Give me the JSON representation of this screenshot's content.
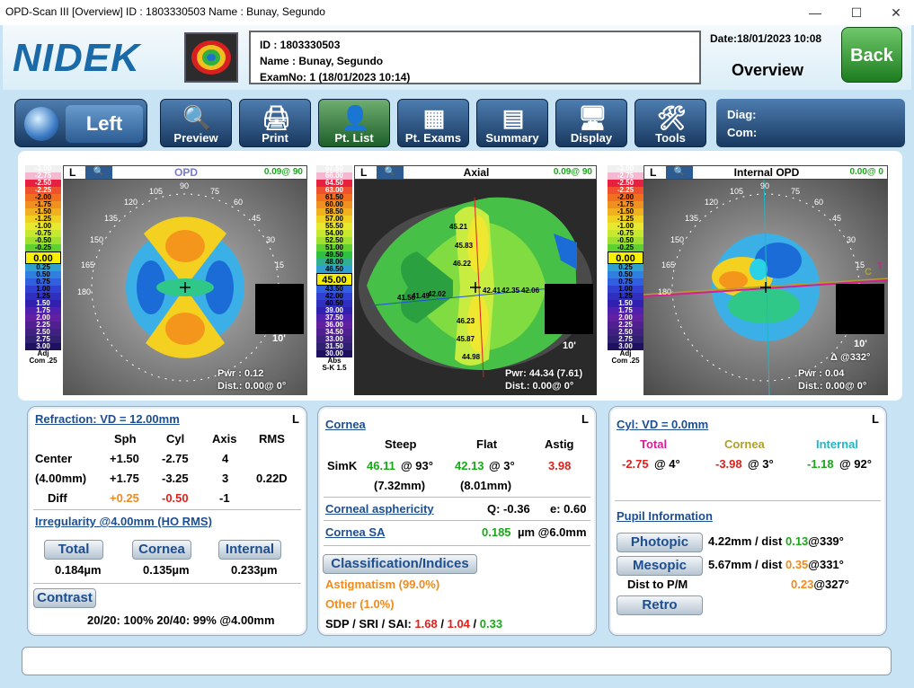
{
  "window": {
    "title": "OPD-Scan III  [Overview]  ID : 1803330503  Name : Bunay,  Segundo",
    "min": "—",
    "max": "☐",
    "close": "✕"
  },
  "header": {
    "logo": "NIDEK",
    "id_line": "ID : 1803330503",
    "name_line": "Name : Bunay,  Segundo",
    "exam_line": "ExamNo: 1 (18/01/2023 10:14)",
    "date": "Date:18/01/2023 10:08",
    "view": "Overview",
    "back": "Back"
  },
  "toolbar": {
    "eye": "Left",
    "buttons": [
      {
        "label": "Preview",
        "icon": "magnifier-icon"
      },
      {
        "label": "Print",
        "icon": "printer-icon"
      },
      {
        "label": "Pt. List",
        "icon": "person-icon"
      },
      {
        "label": "Pt. Exams",
        "icon": "exam-grid-icon"
      },
      {
        "label": "Summary",
        "icon": "summary-icon"
      },
      {
        "label": "Display",
        "icon": "display-icon"
      },
      {
        "label": "Tools",
        "icon": "tools-icon"
      }
    ],
    "diag": "Diag:",
    "com": "Com:"
  },
  "maps": [
    {
      "eye": "L",
      "title": "OPD",
      "angle": "0.09@ 90",
      "pwr": "Pwr :  0.12",
      "dist": "Dist.:  0.00@  0°",
      "scale_label": "Adj",
      "scale_sub": "Com .25",
      "box": "10'",
      "scale": [
        "-3.00",
        "-2.75",
        "-2.50",
        "-2.25",
        "-2.00",
        "-1.75",
        "-1.50",
        "-1.25",
        "-1.00",
        "-0.75",
        "-0.50",
        "-0.25",
        "0.00",
        "0.25",
        "0.50",
        "0.75",
        "1.00",
        "1.25",
        "1.50",
        "1.75",
        "2.00",
        "2.25",
        "2.50",
        "2.75",
        "3.00"
      ],
      "center_index": 12,
      "labels": [
        "90",
        "75",
        "60",
        "45",
        "30",
        "15",
        "105",
        "120",
        "135",
        "150",
        "165",
        "180"
      ]
    },
    {
      "eye": "L",
      "title": "Axial",
      "angle": "0.09@ 90",
      "pwr": "Pwr: 44.34 (7.61)",
      "dist": "Dist.:  0.00@  0°",
      "scale_label": "Abs",
      "scale_sub": "S-K 1.5",
      "box": "10'",
      "scale": [
        "67.50",
        "66.00",
        "64.50",
        "63.00",
        "61.50",
        "60.00",
        "58.50",
        "57.00",
        "55.50",
        "54.00",
        "52.50",
        "51.00",
        "49.50",
        "48.00",
        "46.50",
        "45.00",
        "43.50",
        "42.00",
        "40.50",
        "39.00",
        "37.50",
        "36.00",
        "34.50",
        "33.00",
        "31.50",
        "30.00"
      ],
      "center_index": 15,
      "values": [
        "45.21",
        "45.83",
        "46.22",
        "42.41",
        "42.35",
        "42.06",
        "41.49",
        "42.02",
        "41.56",
        "46.23",
        "45.87",
        "44.98"
      ]
    },
    {
      "eye": "L",
      "title": "Internal OPD",
      "angle": "0.00@  0",
      "pwr": "Pwr :  0.04",
      "dist": "Dist.:  0.00@  0°",
      "scale_label": "Adj",
      "scale_sub": "Com .25",
      "box": "10'",
      "delta": "Δ @332°",
      "scale": [
        "-3.00",
        "-2.75",
        "-2.50",
        "-2.25",
        "-2.00",
        "-1.75",
        "-1.50",
        "-1.25",
        "-1.00",
        "-0.75",
        "-0.50",
        "-0.25",
        "0.00",
        "0.25",
        "0.50",
        "0.75",
        "1.00",
        "1.25",
        "1.50",
        "1.75",
        "2.00",
        "2.25",
        "2.50",
        "2.75",
        "3.00"
      ],
      "center_index": 12,
      "labels": [
        "90",
        "75",
        "60",
        "45",
        "30",
        "15",
        "105",
        "120",
        "135",
        "150",
        "165",
        "180"
      ]
    }
  ],
  "refraction": {
    "title": "Refraction: VD = 12.00mm",
    "eye": "L",
    "headers": [
      "Sph",
      "Cyl",
      "Axis",
      "RMS"
    ],
    "rows": [
      {
        "label": "Center",
        "sph": "+1.50",
        "cyl": "-2.75",
        "axis": "4",
        "rms": ""
      },
      {
        "label": "(4.00mm)",
        "sph": "+1.75",
        "cyl": "-3.25",
        "axis": "3",
        "rms": "0.22D"
      },
      {
        "label": "Diff",
        "sph": "+0.25",
        "cyl": "-0.50",
        "axis": "-1",
        "rms": ""
      }
    ],
    "irregularity": "Irregularity @4.00mm (HO RMS)",
    "total": "Total",
    "cornea": "Cornea",
    "internal": "Internal",
    "total_val": "0.184µm",
    "cornea_val": "0.135µm",
    "internal_val": "0.233µm",
    "contrast": "Contrast",
    "contrast_line": "20/20: 100%  20/40: 99%  @4.00mm"
  },
  "cornea": {
    "title": "Cornea",
    "eye": "L",
    "headers": [
      "Steep",
      "Flat",
      "Astig"
    ],
    "simk": "SimK",
    "steep": "46.11",
    "steep_axis": "@ 93°",
    "flat": "42.13",
    "flat_axis": "@  3°",
    "astig": "3.98",
    "steep_mm": "(7.32mm)",
    "flat_mm": "(8.01mm)",
    "asph_label": "Corneal asphericity",
    "q": "Q: -0.36",
    "e": "e: 0.60",
    "sa_label": "Cornea SA",
    "sa_val": "0.185",
    "sa_unit": "µm @6.0mm",
    "class_btn": "Classification/Indices",
    "astigmatism": "Astigmatism (99.0%)",
    "other": "Other (1.0%)",
    "sdp_label": "SDP / SRI / SAI: ",
    "sdp": "1.68",
    "sri": "1.04",
    "sai": "0.33",
    "slash": " / "
  },
  "cyl": {
    "title": "Cyl: VD = 0.0mm",
    "eye": "L",
    "total": "Total",
    "cornea": "Cornea",
    "internal": "Internal",
    "total_val": "-2.75",
    "total_axis": "@  4°",
    "cornea_val": "-3.98",
    "cornea_axis": "@  3°",
    "internal_val": "-1.18",
    "internal_axis": "@ 92°",
    "pupil": "Pupil Information",
    "photopic": "Photopic",
    "photopic_val": "4.22mm / dist ",
    "photopic_dist": "0.13",
    "photopic_ang": "@339°",
    "mesopic": "Mesopic",
    "mesopic_val": "5.67mm / dist ",
    "mesopic_dist": "0.35",
    "mesopic_ang": "@331°",
    "dist_pm": "Dist to P/M",
    "dist_pm_val": "0.23",
    "dist_pm_ang": "@327°",
    "retro": "Retro"
  },
  "colors": {
    "brand": "#1a6aa8",
    "back_green": "#2e9a30",
    "toolbar_blue": "#1d4a7c",
    "red": "#e0201a",
    "green": "#18a818",
    "orange": "#f08a1c"
  }
}
